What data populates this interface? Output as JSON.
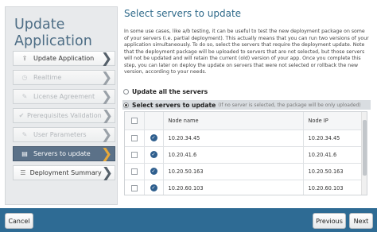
{
  "sidebar": {
    "title_line1": "Update",
    "title_line2": "Application",
    "steps": [
      {
        "label": "Update Application",
        "icon": "upload-icon",
        "state": "enabled"
      },
      {
        "label": "Realtime",
        "icon": "clock-icon",
        "state": "disabled"
      },
      {
        "label": "License Agreement",
        "icon": "pen-icon",
        "state": "disabled"
      },
      {
        "label": "Prerequisites Validation",
        "icon": "check-icon",
        "state": "disabled"
      },
      {
        "label": "User Parameters",
        "icon": "pen-icon",
        "state": "disabled"
      },
      {
        "label": "Servers to update",
        "icon": "server-icon",
        "state": "active"
      },
      {
        "label": "Deployment Summary",
        "icon": "list-icon",
        "state": "enabled"
      }
    ]
  },
  "main": {
    "title": "Select servers to update",
    "description": "In some use cases, like a/b testing, it can be useful to test the new deployment package on some of your servers (i.e. partial deployment). This actually means that you can run two versions of your application simultaneously. To do so, select the servers that require the deployment update. Note that the deployment package will be uploaded to servers that are not selected, but those servers will not be updated and will retain the current (old) version of your app. Once you complete this step, you can later on deploy the update on servers that were not selected or rollback the new version, according to your needs.",
    "option_all": "Update all the servers",
    "option_select": "Select servers to update",
    "option_select_note": "(If no server is selected, the package will be only uploaded)"
  },
  "table": {
    "headers": {
      "name": "Node name",
      "ip": "Node IP"
    },
    "rows": [
      {
        "name": "10.20.34.45",
        "ip": "10.20.34.45"
      },
      {
        "name": "10.20.41.6",
        "ip": "10.20.41.6"
      },
      {
        "name": "10.20.50.163",
        "ip": "10.20.50.163"
      },
      {
        "name": "10.20.60.103",
        "ip": "10.20.60.103"
      }
    ]
  },
  "footer": {
    "cancel_label": "Cancel",
    "previous_label": "Previous",
    "next_label": "Next"
  },
  "colors": {
    "footer": "#2e6b94",
    "active_step": "#5b7188",
    "title": "#2f6a8a",
    "chevron_active": "#e8a93a"
  }
}
